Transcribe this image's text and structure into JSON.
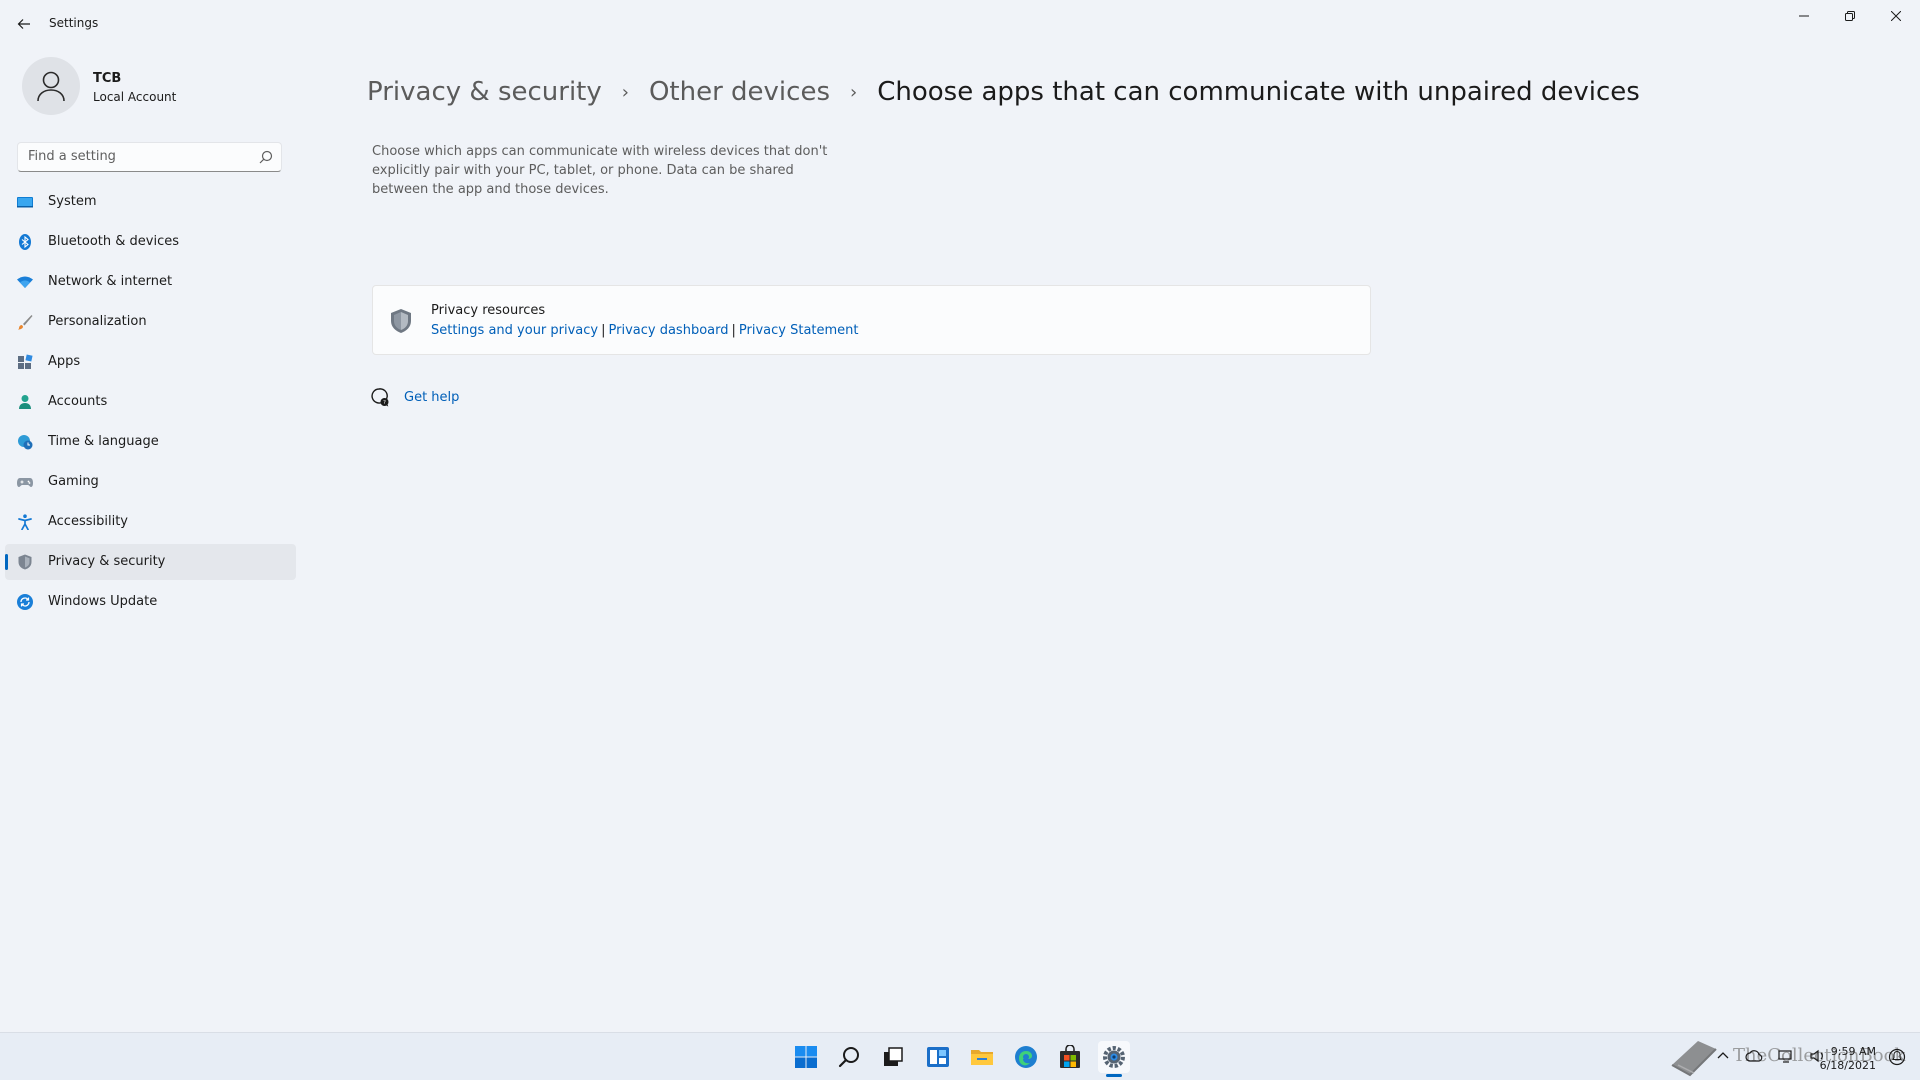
{
  "window": {
    "title": "Settings"
  },
  "account": {
    "name": "TCB",
    "type": "Local Account"
  },
  "search": {
    "placeholder": "Find a setting",
    "value": ""
  },
  "sidebar": {
    "items": [
      {
        "label": "System",
        "icon": "system-icon"
      },
      {
        "label": "Bluetooth & devices",
        "icon": "bluetooth-icon"
      },
      {
        "label": "Network & internet",
        "icon": "wifi-icon"
      },
      {
        "label": "Personalization",
        "icon": "brush-icon"
      },
      {
        "label": "Apps",
        "icon": "apps-icon"
      },
      {
        "label": "Accounts",
        "icon": "person-icon"
      },
      {
        "label": "Time & language",
        "icon": "globe-clock-icon"
      },
      {
        "label": "Gaming",
        "icon": "gamepad-icon"
      },
      {
        "label": "Accessibility",
        "icon": "accessibility-icon"
      },
      {
        "label": "Privacy & security",
        "icon": "shield-icon",
        "selected": true
      },
      {
        "label": "Windows Update",
        "icon": "update-icon"
      }
    ]
  },
  "breadcrumb": {
    "items": [
      "Privacy & security",
      "Other devices"
    ],
    "current": "Choose apps that can communicate with unpaired devices",
    "separator": "›"
  },
  "main": {
    "description": "Choose which apps can communicate with wireless devices that don't explicitly pair with your PC, tablet, or phone. Data can be shared between the app and those devices."
  },
  "resources": {
    "title": "Privacy resources",
    "links": [
      "Settings and your privacy",
      "Privacy dashboard",
      "Privacy Statement"
    ],
    "separator": "|"
  },
  "help": {
    "label": "Get help"
  },
  "taskbar": {
    "icons": [
      "start-icon",
      "search-icon",
      "task-view-icon",
      "widgets-icon",
      "file-explorer-icon",
      "edge-icon",
      "store-icon",
      "settings-icon"
    ],
    "active": "settings-icon"
  },
  "clock": {
    "time": "9:59 AM",
    "date": "6/18/2021"
  },
  "watermark": {
    "text": "TheCollectionBook"
  },
  "colors": {
    "accent": "#0067c0",
    "link": "#005fb8",
    "background": "#f0f3f8"
  }
}
